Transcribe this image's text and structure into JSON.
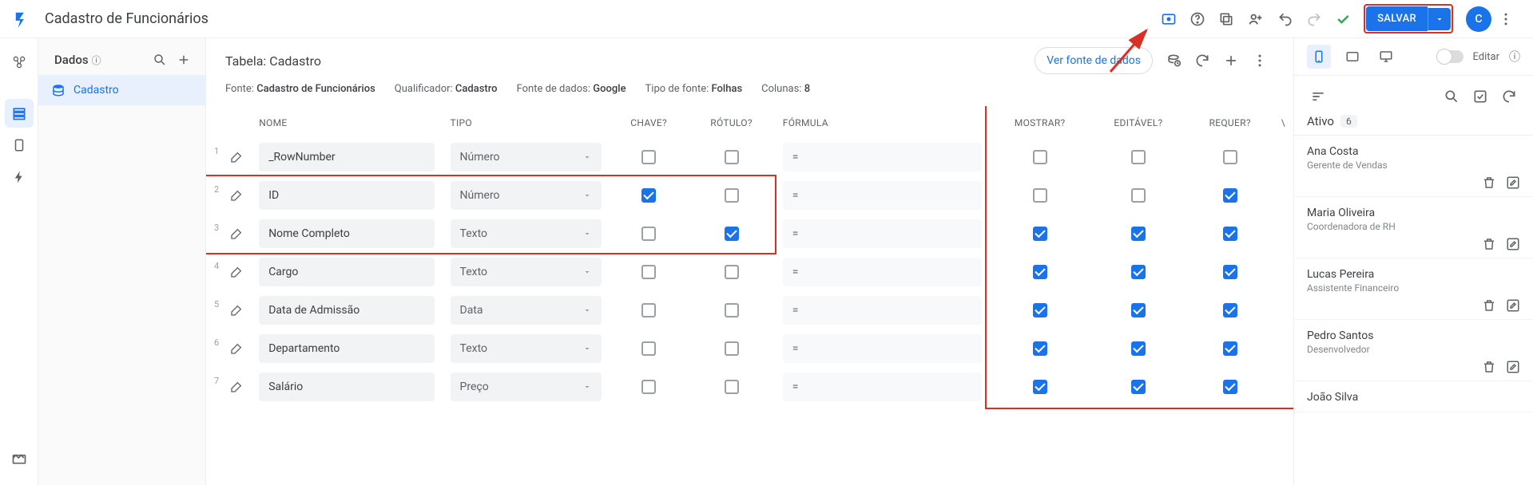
{
  "header": {
    "title": "Cadastro de Funcionários",
    "save_label": "SALVAR",
    "avatar_letter": "C"
  },
  "left": {
    "section": "Dados",
    "items": [
      {
        "label": "Cadastro"
      }
    ]
  },
  "center": {
    "table_title": "Tabela: Cadastro",
    "view_source": "Ver fonte de dados",
    "meta": {
      "fonte_lbl": "Fonte:",
      "fonte_val": "Cadastro de Funcionários",
      "qual_lbl": "Qualificador:",
      "qual_val": "Cadastro",
      "ds_lbl": "Fonte de dados:",
      "ds_val": "Google",
      "tipo_lbl": "Tipo de fonte:",
      "tipo_val": "Folhas",
      "col_lbl": "Colunas:",
      "col_val": "8"
    },
    "headers": {
      "nome": "NOME",
      "tipo": "TIPO",
      "chave": "CHAVE?",
      "rotulo": "RÓTULO?",
      "formula": "FÓRMULA",
      "mostrar": "MOSTRAR?",
      "editavel": "EDITÁVEL?",
      "requer": "REQUER?"
    },
    "rows": [
      {
        "n": "1",
        "name": "_RowNumber",
        "type": "Número",
        "chave": false,
        "rotulo": false,
        "formula": "=",
        "mostrar": false,
        "editavel": false,
        "requer": false
      },
      {
        "n": "2",
        "name": "ID",
        "type": "Número",
        "chave": true,
        "rotulo": false,
        "formula": "=",
        "mostrar": false,
        "editavel": false,
        "requer": true
      },
      {
        "n": "3",
        "name": "Nome Completo",
        "type": "Texto",
        "chave": false,
        "rotulo": true,
        "formula": "=",
        "mostrar": true,
        "editavel": true,
        "requer": true
      },
      {
        "n": "4",
        "name": "Cargo",
        "type": "Texto",
        "chave": false,
        "rotulo": false,
        "formula": "=",
        "mostrar": true,
        "editavel": true,
        "requer": true
      },
      {
        "n": "5",
        "name": "Data de Admissão",
        "type": "Data",
        "chave": false,
        "rotulo": false,
        "formula": "=",
        "mostrar": true,
        "editavel": true,
        "requer": true
      },
      {
        "n": "6",
        "name": "Departamento",
        "type": "Texto",
        "chave": false,
        "rotulo": false,
        "formula": "=",
        "mostrar": true,
        "editavel": true,
        "requer": true
      },
      {
        "n": "7",
        "name": "Salário",
        "type": "Preço",
        "chave": false,
        "rotulo": false,
        "formula": "=",
        "mostrar": true,
        "editavel": true,
        "requer": true
      }
    ]
  },
  "right": {
    "edit_label": "Editar",
    "status_label": "Ativo",
    "status_count": "6",
    "records": [
      {
        "name": "Ana Costa",
        "role": "Gerente de Vendas"
      },
      {
        "name": "Maria Oliveira",
        "role": "Coordenadora de RH"
      },
      {
        "name": "Lucas Pereira",
        "role": "Assistente Financeiro"
      },
      {
        "name": "Pedro Santos",
        "role": "Desenvolvedor"
      },
      {
        "name": "João Silva",
        "role": ""
      }
    ]
  }
}
